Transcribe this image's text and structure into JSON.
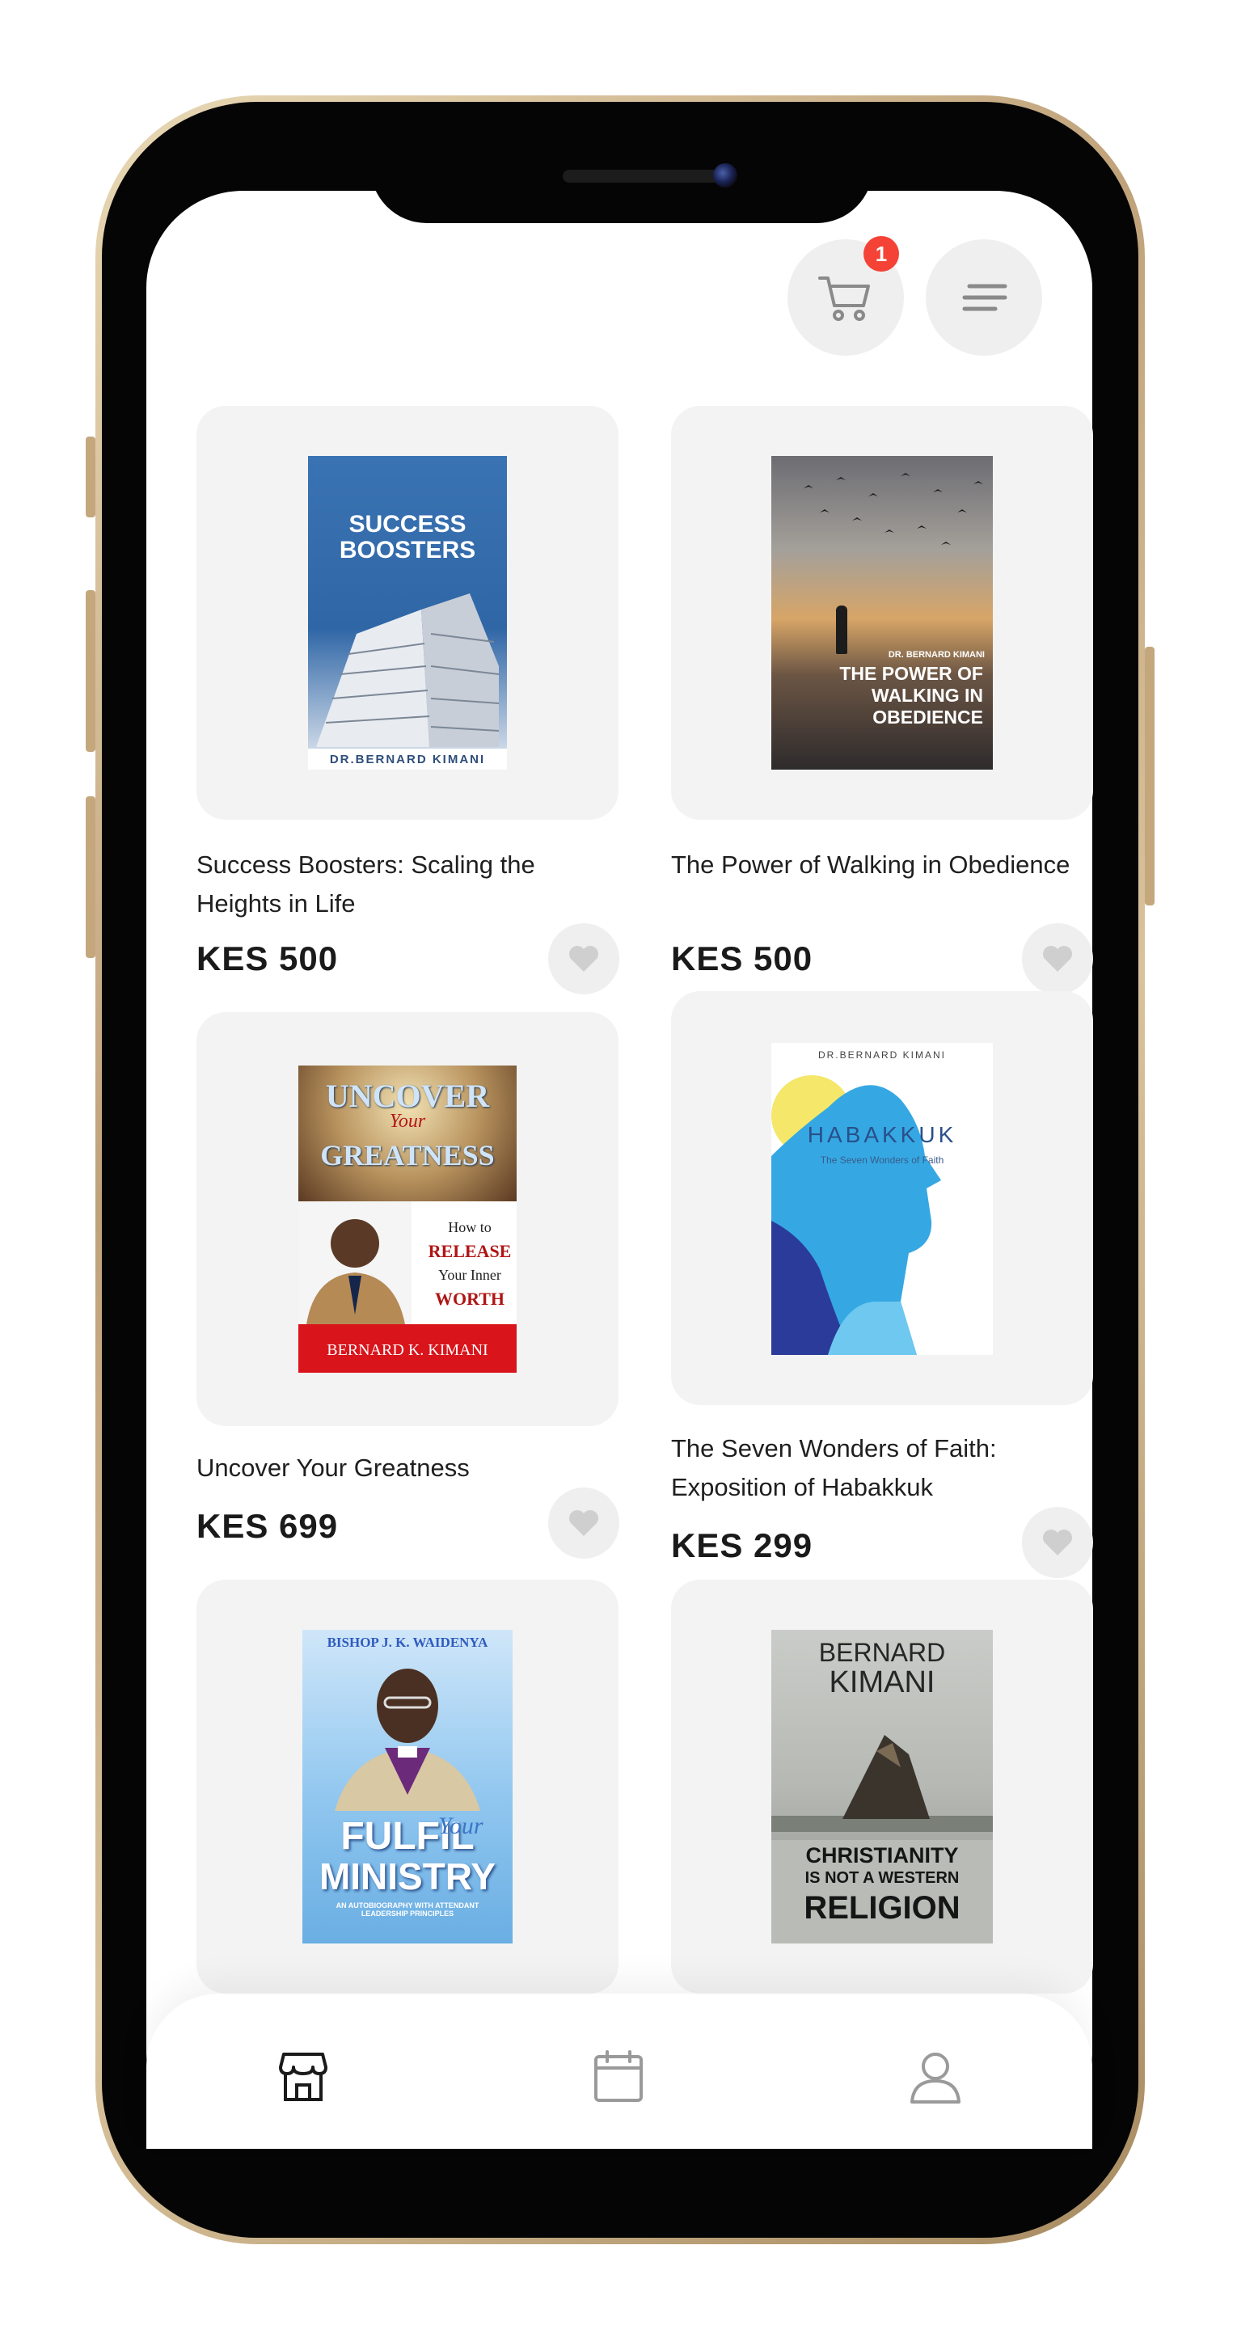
{
  "header": {
    "cart_count": "1"
  },
  "products": [
    {
      "title": "Success Boosters: Scaling the Heights in Life",
      "price": "KES 500",
      "cover": {
        "title_line1": "SUCCESS",
        "title_line2": "BOOSTERS",
        "author": "DR.BERNARD KIMANI"
      }
    },
    {
      "title": "The Power of Walking in Obedience",
      "price": "KES 500",
      "cover": {
        "author": "DR. BERNARD KIMANI",
        "title_line1": "THE POWER OF",
        "title_line2": "WALKING IN",
        "title_line3": "OBEDIENCE"
      }
    },
    {
      "title": "Uncover Your Greatness",
      "price": "KES 699",
      "cover": {
        "title_line1": "UNCOVER",
        "title_line2": "Your",
        "title_line3": "GREATNESS",
        "sub1": "How to",
        "sub2": "RELEASE",
        "sub3": "Your Inner",
        "sub4": "WORTH",
        "author": "BERNARD K. KIMANI"
      }
    },
    {
      "title": "The Seven Wonders of Faith: Exposition of Habakkuk",
      "price": "KES 299",
      "cover": {
        "author": "DR.BERNARD KIMANI",
        "title": "HABAKKUK",
        "subtitle": "The Seven Wonders of Faith"
      }
    },
    {
      "title": "",
      "price": "",
      "cover": {
        "author": "BISHOP J. K. WAIDENYA",
        "title_line1": "FULFIL",
        "title_script": "Your",
        "title_line2": "MINISTRY",
        "sub": "AN AUTOBIOGRAPHY WITH ATTENDANT LEADERSHIP PRINCIPLES"
      }
    },
    {
      "title": "",
      "price": "",
      "cover": {
        "author_line1": "BERNARD",
        "author_line2": "KIMANI",
        "title_line1": "CHRISTIANITY",
        "title_line2": "IS NOT A WESTERN",
        "title_line3": "RELIGION"
      }
    }
  ],
  "bottom_nav": [
    "store",
    "calendar",
    "profile"
  ],
  "colors": {
    "badge": "#f44336",
    "card_bg": "#f3f3f3",
    "active_icon": "#1a1a1a",
    "inactive_icon": "#9a9a9a"
  }
}
